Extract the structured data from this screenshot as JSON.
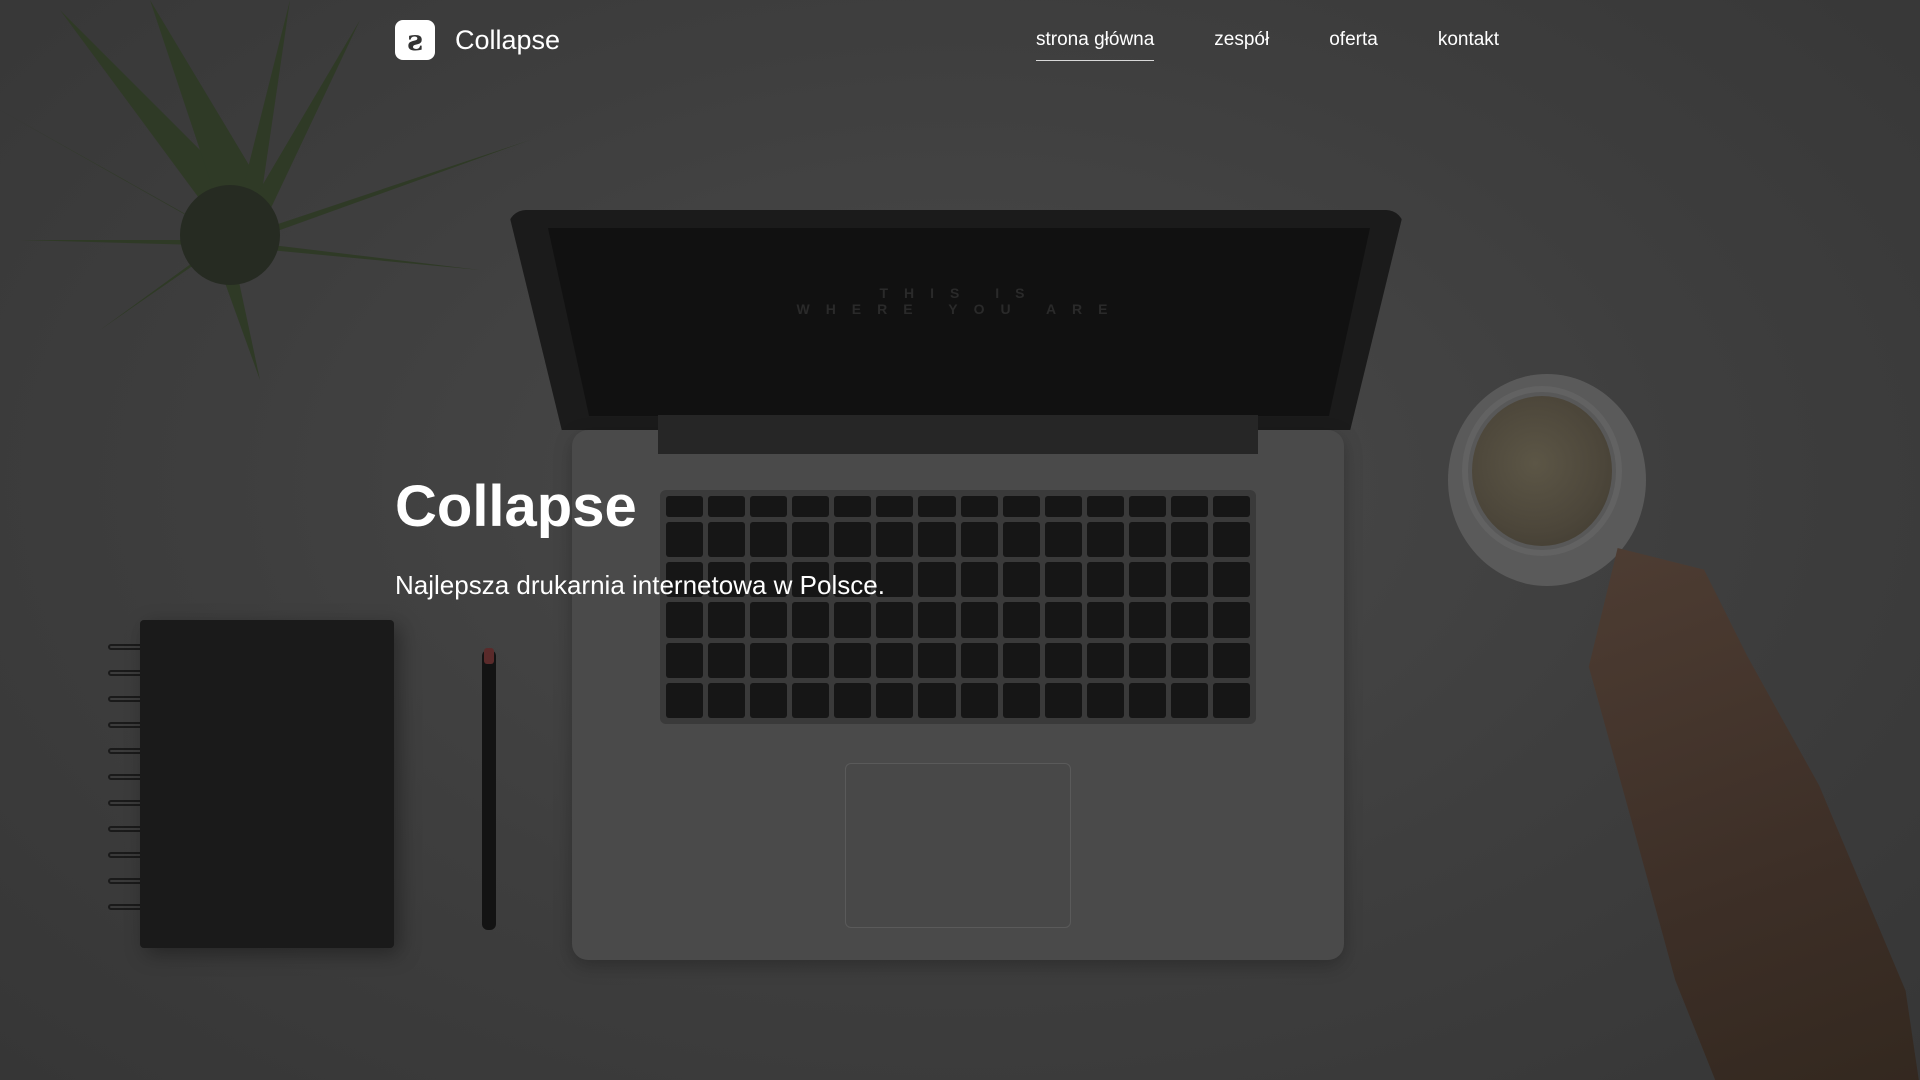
{
  "brand": {
    "name": "Collapse",
    "logo_icon": "collapse-logo-icon"
  },
  "nav": {
    "items": [
      {
        "label": "strona główna",
        "active": true
      },
      {
        "label": "zespół",
        "active": false
      },
      {
        "label": "oferta",
        "active": false
      },
      {
        "label": "kontakt",
        "active": false
      }
    ]
  },
  "hero": {
    "title": "Collapse",
    "subtitle": "Najlepsza drukarnia internetowa w Polsce.",
    "screen_line_1": "THIS IS",
    "screen_line_2": "WHERE YOU ARE"
  },
  "colors": {
    "overlay": "#3f3f3f",
    "text": "#ffffff"
  }
}
